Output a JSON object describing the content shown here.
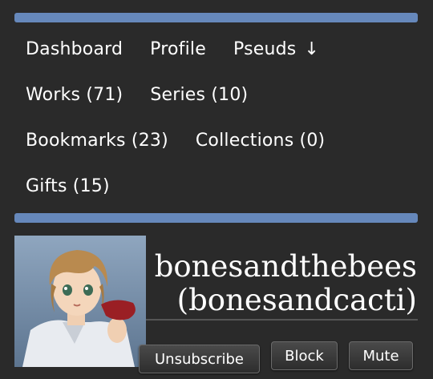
{
  "nav": {
    "dashboard": "Dashboard",
    "profile": "Profile",
    "pseuds": "Pseuds",
    "pseuds_arrow": "↓",
    "works": "Works (71)",
    "series": "Series (10)",
    "bookmarks": "Bookmarks (23)",
    "collections": "Collections (0)",
    "gifts": "Gifts (15)"
  },
  "user": {
    "pseud": "bonesandthebees",
    "username": "(bonesandcacti)",
    "avatar_icon": "anime-character-avatar"
  },
  "actions": {
    "unsubscribe": "Unsubscribe",
    "block": "Block",
    "mute": "Mute"
  },
  "colors": {
    "background": "#2a2a2a",
    "accent_bar": "#6688bb",
    "text": "#ffffff"
  }
}
